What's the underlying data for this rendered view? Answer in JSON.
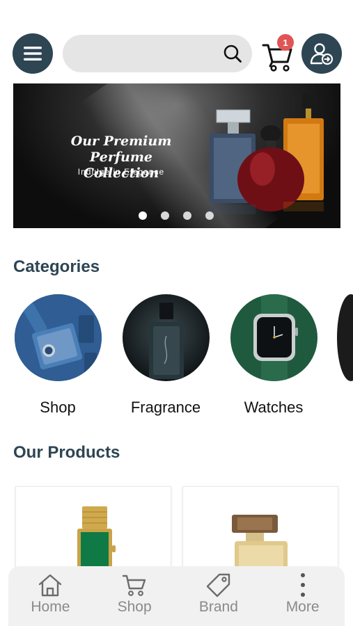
{
  "header": {
    "menu_icon": "hamburger-menu-icon",
    "search": {
      "value": "",
      "placeholder": "",
      "icon": "search-icon"
    },
    "cart": {
      "icon": "shopping-cart-icon",
      "badge_count": "1"
    },
    "account_icon": "user-account-icon"
  },
  "banner": {
    "title": "Our Premium\nPerfume Collection",
    "subtitle": "Indulge in Elegance",
    "slide_count": 4,
    "active_slide": 1
  },
  "categories": {
    "title": "Categories",
    "items": [
      {
        "label": "Shop"
      },
      {
        "label": "Fragrance"
      },
      {
        "label": "Watches"
      }
    ]
  },
  "products": {
    "title": "Our Products"
  },
  "bottom_nav": {
    "items": [
      {
        "label": "Home",
        "icon": "home-icon"
      },
      {
        "label": "Shop",
        "icon": "cart-icon"
      },
      {
        "label": "Brand",
        "icon": "tag-icon"
      },
      {
        "label": "More",
        "icon": "more-vertical-icon"
      }
    ]
  },
  "colors": {
    "primary": "#2e4553",
    "badge": "#e05555",
    "search_bg": "#e5e5e5",
    "nav_bg": "#f1f1f1",
    "nav_text": "#8a8a8a"
  }
}
